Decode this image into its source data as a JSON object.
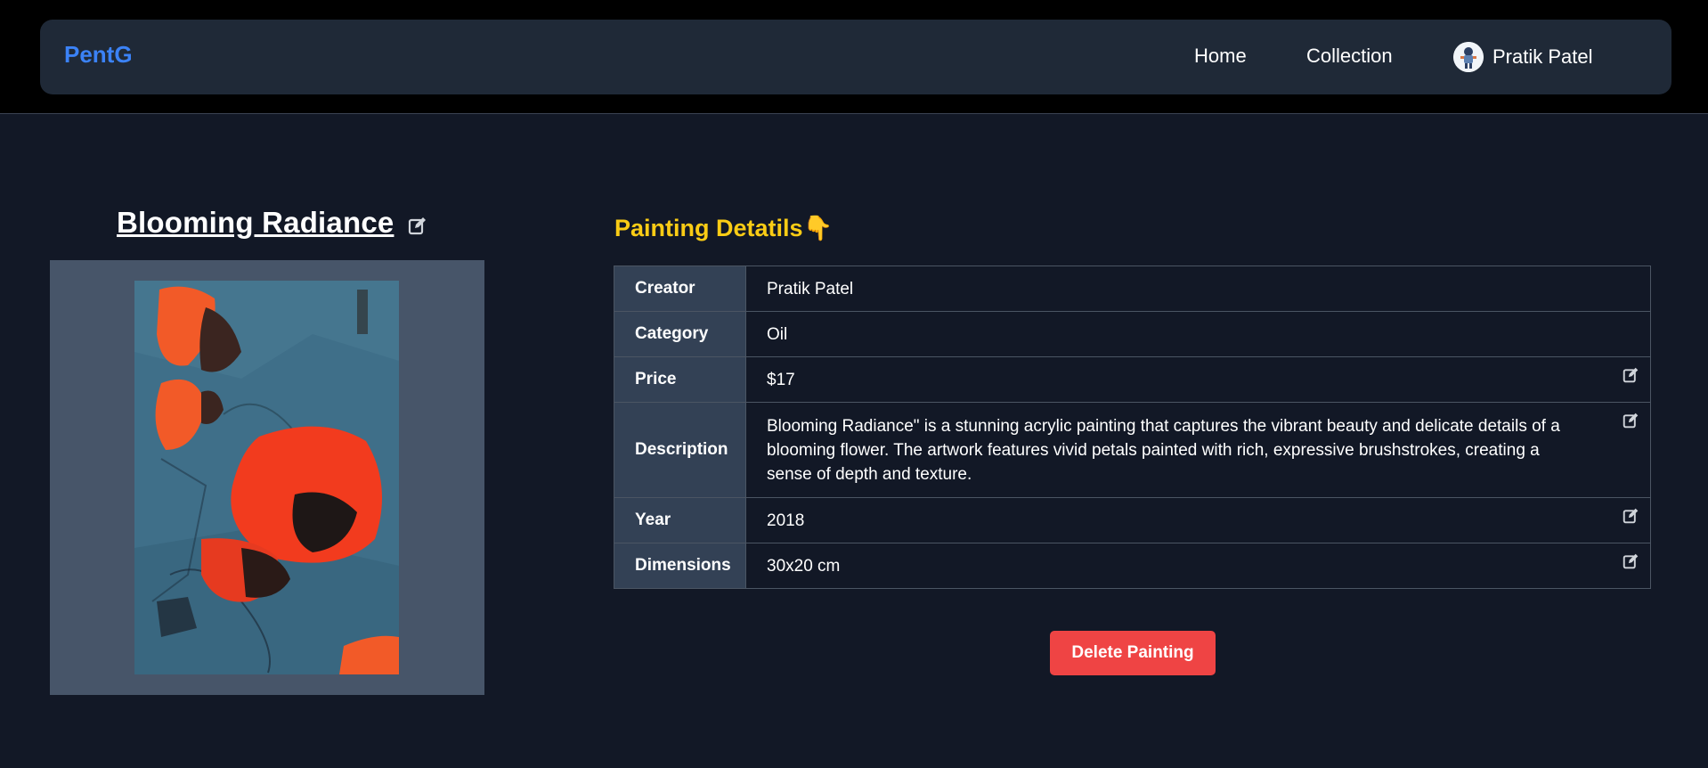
{
  "nav": {
    "brand": "PentG",
    "links": [
      "Home",
      "Collection"
    ],
    "user_name": "Pratik Patel"
  },
  "painting": {
    "title": "Blooming Radiance"
  },
  "details": {
    "heading": "Painting Detatils👇",
    "rows": [
      {
        "key": "Creator",
        "value": "Pratik Patel"
      },
      {
        "key": "Category",
        "value": "Oil"
      },
      {
        "key": "Price",
        "value": "$17"
      },
      {
        "key": "Description",
        "value": "Blooming Radiance\" is a stunning acrylic painting that captures the vibrant beauty and delicate details of a blooming flower. The artwork features vivid petals painted with rich, expressive brushstrokes, creating a sense of depth and texture."
      },
      {
        "key": "Year",
        "value": "2018"
      },
      {
        "key": "Dimensions",
        "value": "30x20 cm"
      }
    ]
  },
  "actions": {
    "delete_label": "Delete Painting"
  },
  "colors": {
    "brand": "#3b82f6",
    "heading": "#facc15",
    "delete": "#ef4444",
    "background": "#121826"
  },
  "icons": {
    "edit": "pencil-square-icon",
    "heading_emoji": "pointing-down-hand"
  }
}
